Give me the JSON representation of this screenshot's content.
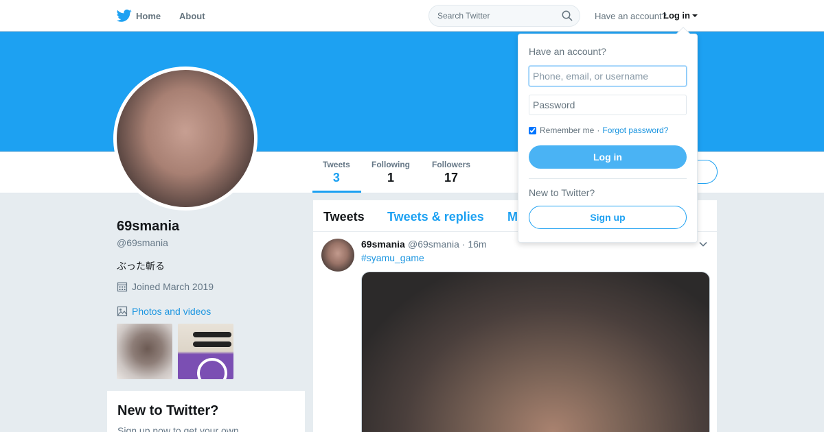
{
  "nav": {
    "home_label": "Home",
    "about_label": "About",
    "search_placeholder": "Search Twitter",
    "have_account": "Have an account?",
    "login_label": "Log in"
  },
  "colors": {
    "brand": "#1da1f2",
    "link": "#1b95e0",
    "banner": "#1da1f2"
  },
  "stats": {
    "tweets": {
      "label": "Tweets",
      "value": "3"
    },
    "following": {
      "label": "Following",
      "value": "1"
    },
    "followers": {
      "label": "Followers",
      "value": "17"
    }
  },
  "profile": {
    "name": "69smania",
    "handle": "@69smania",
    "bio": "ぶった斬る",
    "joined": "Joined March 2019",
    "photos_label": "Photos and videos"
  },
  "signup_card": {
    "title": "New to Twitter?",
    "text": "Sign up now to get your own"
  },
  "timeline": {
    "tabs": [
      "Tweets",
      "Tweets & replies",
      "M"
    ],
    "tweet": {
      "name": "69smania",
      "handle": "@69smania",
      "time": "· 16m",
      "hashtag": "#syamu_game"
    }
  },
  "login_dropdown": {
    "title": "Have an account?",
    "username_placeholder": "Phone, email, or username",
    "password_placeholder": "Password",
    "remember_label": "Remember me",
    "separator": "·",
    "forgot_label": "Forgot password?",
    "login_button": "Log in",
    "new_label": "New to Twitter?",
    "signup_button": "Sign up"
  },
  "icons": [
    "twitter-bird-icon",
    "search-icon",
    "caret-down-icon",
    "calendar-icon",
    "photo-icon",
    "chevron-down-icon"
  ]
}
